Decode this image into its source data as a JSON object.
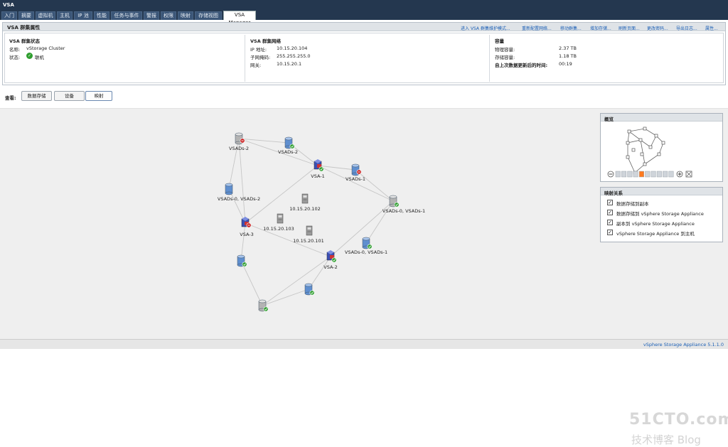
{
  "window": {
    "title": "VSA"
  },
  "tabs": [
    "入门",
    "摘要",
    "虚拟机",
    "主机",
    "IP 池",
    "性能",
    "任务与事件",
    "警报",
    "权限",
    "映射",
    "存储视图",
    "VSA Manager"
  ],
  "properties": {
    "title": "VSA 群集属性",
    "actions": [
      "进入 VSA 群集维护模式...",
      "重新配置网络...",
      "移动群集...",
      "增加存储...",
      "刷新页面...",
      "更改密码...",
      "导出日志...",
      "属性..."
    ],
    "cluster": {
      "heading": "VSA 群集状态",
      "name_label": "名称:",
      "name_value": "vStorage Cluster",
      "status_label": "状态:",
      "status_value": "联机"
    },
    "network": {
      "heading": "VSA 群集网络",
      "ip_label": "IP 地址:",
      "ip_value": "10.15.20.104",
      "mask_label": "子网掩码:",
      "mask_value": "255.255.255.0",
      "gw_label": "网关:",
      "gw_value": "10.15.20.1"
    },
    "capacity": {
      "heading": "容量",
      "physical_label": "物理容量:",
      "physical_value": "2.37 TB",
      "storage_label": "存储容量:",
      "storage_value": "1.18 TB",
      "updated_label": "自上次数据更新后的时间:",
      "updated_value": "00:19"
    }
  },
  "viewbar": {
    "label": "查看:",
    "buttons": [
      "数据存储",
      "设备",
      "映射"
    ],
    "selected": "映射"
  },
  "map": {
    "nodes": [
      {
        "id": "n1",
        "type": "datastore-gray",
        "status": "error",
        "label": "VSADs-2"
      },
      {
        "id": "n2",
        "type": "datastore",
        "status": "ok",
        "label": "VSADs-2"
      },
      {
        "id": "n3",
        "type": "host",
        "status": "ok",
        "label": "VSA-1"
      },
      {
        "id": "n4",
        "type": "datastore",
        "status": "error",
        "label": "VSADs-1"
      },
      {
        "id": "n5",
        "type": "datastore",
        "status": "none",
        "label": "VSADs-0, VSADs-2"
      },
      {
        "id": "n6",
        "type": "server",
        "status": "none",
        "label": "10.15.20.102"
      },
      {
        "id": "n7",
        "type": "datastore-gray",
        "status": "ok",
        "label": "VSADs-0, VSADs-1"
      },
      {
        "id": "n8",
        "type": "host",
        "status": "error",
        "label": "VSA-3"
      },
      {
        "id": "n9",
        "type": "server",
        "status": "none",
        "label": "10.15.20.103"
      },
      {
        "id": "n10",
        "type": "server",
        "status": "none",
        "label": "10.15.20.101"
      },
      {
        "id": "n11",
        "type": "datastore",
        "status": "ok",
        "label": "VSADs-0, VSADs-1"
      },
      {
        "id": "n12",
        "type": "host",
        "status": "ok",
        "label": "VSA-2"
      },
      {
        "id": "n13",
        "type": "datastore",
        "status": "ok",
        "label": ""
      },
      {
        "id": "n14",
        "type": "datastore",
        "status": "ok",
        "label": ""
      },
      {
        "id": "n15",
        "type": "datastore-gray",
        "status": "ok",
        "label": ""
      }
    ],
    "edges": [
      [
        "n1",
        "n2"
      ],
      [
        "n2",
        "n3"
      ],
      [
        "n3",
        "n4"
      ],
      [
        "n4",
        "n7"
      ],
      [
        "n1",
        "n3"
      ],
      [
        "n1",
        "n5"
      ],
      [
        "n1",
        "n8"
      ],
      [
        "n5",
        "n8"
      ],
      [
        "n3",
        "n8"
      ],
      [
        "n3",
        "n7"
      ],
      [
        "n8",
        "n13"
      ],
      [
        "n13",
        "n15"
      ],
      [
        "n8",
        "n12"
      ],
      [
        "n12",
        "n14"
      ],
      [
        "n14",
        "n15"
      ],
      [
        "n12",
        "n15"
      ],
      [
        "n7",
        "n12"
      ],
      [
        "n7",
        "n11"
      ]
    ]
  },
  "overview": {
    "title": "概览"
  },
  "relations": {
    "title": "映射关系",
    "items": [
      {
        "label": "数据存储到副本",
        "checked": true
      },
      {
        "label": "数据存储到 vSphere Storage Appliance",
        "checked": true
      },
      {
        "label": "副本到 vSphere Storage Appliance",
        "checked": true
      },
      {
        "label": "vSphere Storage Appliance 到主机",
        "checked": true
      }
    ]
  },
  "status": {
    "version": "vSphere Storage Appliance 5.1.1.0"
  },
  "watermark": {
    "line1": "51CTO.com",
    "line2": "技术博客 Blog"
  },
  "colors": {
    "header": "#24374f",
    "link": "#1b5fb5",
    "ok": "#2f9e2f",
    "error": "#cc2222",
    "edge": "#c6c6c6"
  }
}
